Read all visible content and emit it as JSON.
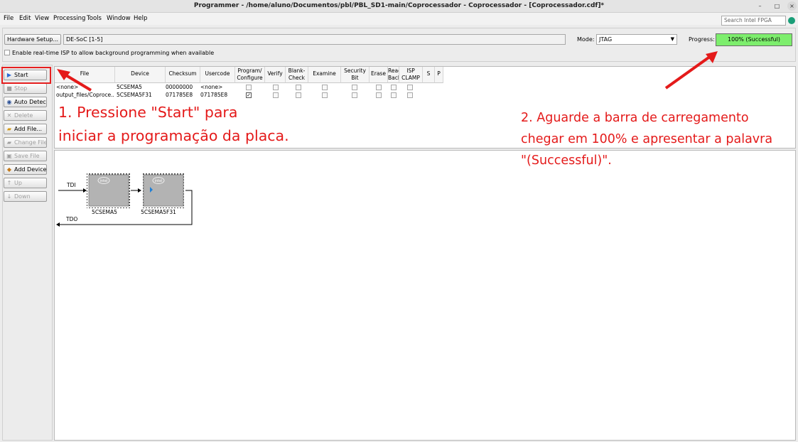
{
  "window": {
    "title": "Programmer - /home/aluno/Documentos/pbl/PBL_SD1-main/Coprocessador - Coprocessador - [Coprocessador.cdf]*",
    "min": "–",
    "max": "□",
    "close": "×"
  },
  "menu": [
    "File",
    "Edit",
    "View",
    "Processing",
    "Tools",
    "Window",
    "Help"
  ],
  "search": {
    "placeholder": "Search Intel FPGA"
  },
  "hardware": {
    "button": "Hardware Setup...",
    "value": "DE-SoC [1-5]"
  },
  "mode": {
    "label": "Mode:",
    "value": "JTAG"
  },
  "progress": {
    "label": "Progress:",
    "percent": 100,
    "text": "100% (Successful)"
  },
  "isp": {
    "label": "Enable real-time ISP to allow background programming when available",
    "checked": false
  },
  "sidebar": [
    {
      "label": "Start",
      "enabled": true
    },
    {
      "label": "Stop",
      "enabled": false
    },
    {
      "label": "Auto Detect",
      "enabled": true
    },
    {
      "label": "Delete",
      "enabled": false
    },
    {
      "label": "Add File...",
      "enabled": true
    },
    {
      "label": "Change File...",
      "enabled": false
    },
    {
      "label": "Save File",
      "enabled": false
    },
    {
      "label": "Add Device...",
      "enabled": true
    },
    {
      "label": "Up",
      "enabled": false
    },
    {
      "label": "Down",
      "enabled": false
    }
  ],
  "table": {
    "headers": [
      "File",
      "Device",
      "Checksum",
      "Usercode",
      "Program/\nConfigure",
      "Verify",
      "Blank-\nCheck",
      "Examine",
      "Security\nBit",
      "Erase",
      "Read\nBacks",
      "ISP\nCLAMP",
      "S Fi...",
      "P F"
    ],
    "rows": [
      {
        "file": "<none>",
        "device": "5CSEMA5",
        "checksum": "00000000",
        "usercode": "<none>",
        "program": false
      },
      {
        "file": "output_files/Coproce...",
        "device": "5CSEMA5F31",
        "checksum": "071785E8",
        "usercode": "071785E8",
        "program": true
      }
    ]
  },
  "chain": {
    "tdi": "TDI",
    "tdo": "TDO",
    "chips": [
      "5CSEMA5",
      "5CSEMA5F31"
    ],
    "chip_logo": "intel"
  },
  "annotations": {
    "step1": [
      "1. Pressione \"Start\" para",
      "iniciar a programação da placa."
    ],
    "step2": [
      "2. Aguarde a barra de carregamento",
      "chegar em 100% e apresentar a palavra",
      "\"(Successful)\"."
    ]
  },
  "colors": {
    "progress": "#7dee6d",
    "annotation": "#e41a1a"
  }
}
